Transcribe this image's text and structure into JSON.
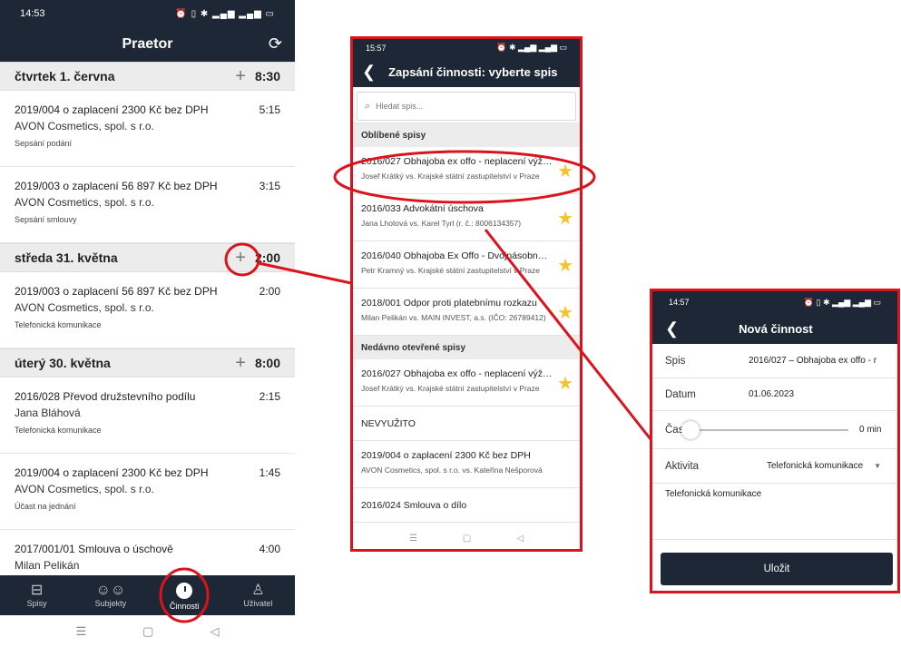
{
  "phone1": {
    "status_time": "14:53",
    "title": "Praetor",
    "days": [
      {
        "label": "čtvrtek 1. června",
        "total": "8:30",
        "entries": [
          {
            "title": "2019/004 o zaplacení 2300 Kč bez DPH",
            "client": "AVON Cosmetics, spol. s r.o.",
            "activity": "Sepsání podání",
            "time": "5:15"
          },
          {
            "title": "2019/003 o zaplacení 56 897 Kč bez DPH",
            "client": "AVON Cosmetics, spol. s r.o.",
            "activity": "Sepsání smlouvy",
            "time": "3:15"
          }
        ]
      },
      {
        "label": "středa 31. května",
        "total": "2:00",
        "entries": [
          {
            "title": "2019/003 o zaplacení 56 897 Kč bez DPH",
            "client": "AVON Cosmetics, spol. s r.o.",
            "activity": "Telefonická komunikace",
            "time": "2:00"
          }
        ]
      },
      {
        "label": "úterý 30. května",
        "total": "8:00",
        "entries": [
          {
            "title": "2016/028 Převod družstevního podílu",
            "client": "Jana Bláhová",
            "activity": "Telefonická komunikace",
            "time": "2:15"
          },
          {
            "title": "2019/004 o zaplacení 2300 Kč bez DPH",
            "client": "AVON Cosmetics, spol. s r.o.",
            "activity": "Účast na jednání",
            "time": "1:45"
          },
          {
            "title": "2017/001/01 Smlouva o úschově",
            "client": "Milan Pelikán",
            "activity": "",
            "time": "4:00"
          }
        ]
      }
    ],
    "tabs": [
      "Spisy",
      "Subjekty",
      "Činnosti",
      "Uživatel"
    ]
  },
  "phone2": {
    "status_time": "15:57",
    "title": "Zapsání činnosti: vyberte spis",
    "search_placeholder": "Hledat spis...",
    "favorites_label": "Oblíbené spisy",
    "favorites": [
      {
        "title": "2016/027 Obhajoba ex offo - neplacení výživného",
        "sub": "Josef Krátký vs. Krajské státní zastupitelství v Praze"
      },
      {
        "title": "2016/033 Advokátní úschova",
        "sub": "Jana Lhotová vs. Karel Tyrl (r. č.: 8006134357)"
      },
      {
        "title": "2016/040 Obhajoba Ex Offo - Dvojnásobná krádež",
        "sub": "Petr Kramný vs. Krajské státní zastupitelství v Praze"
      },
      {
        "title": "2018/001 Odpor proti platebnímu rozkazu",
        "sub": "Milan Pelikán vs. MAIN INVEST, a.s. (IČO: 26789412)"
      }
    ],
    "recent_label": "Nedávno otevřené spisy",
    "recent": [
      {
        "title": "2016/027 Obhajoba ex offo - neplacení výživného",
        "sub": "Josef Krátký vs. Krajské státní zastupitelství v Praze",
        "star": true
      },
      {
        "title": "NEVYUŽITO",
        "plain": true
      },
      {
        "title": "2019/004 o zaplacení 2300 Kč bez DPH",
        "sub": "AVON Cosmetics, spol. s r.o. vs. Kateřina Nešporová"
      },
      {
        "title": "2016/024 Smlouva o dílo",
        "plain": true
      }
    ]
  },
  "phone3": {
    "status_time": "14:57",
    "title": "Nová činnost",
    "spis_label": "Spis",
    "spis_value": "2016/027 – Obhajoba ex offo - r",
    "datum_label": "Datum",
    "datum_value": "01.06.2023",
    "cas_label": "Čas",
    "cas_value": "0 min",
    "cas_level": 0,
    "aktivita_label": "Aktivita",
    "aktivita_value": "Telefonická komunikace",
    "note": "Telefonická komunikace",
    "save": "Uložit"
  },
  "colors": {
    "appbar": "#1e2736",
    "annotation": "#d9141d",
    "star": "#f4c430"
  }
}
